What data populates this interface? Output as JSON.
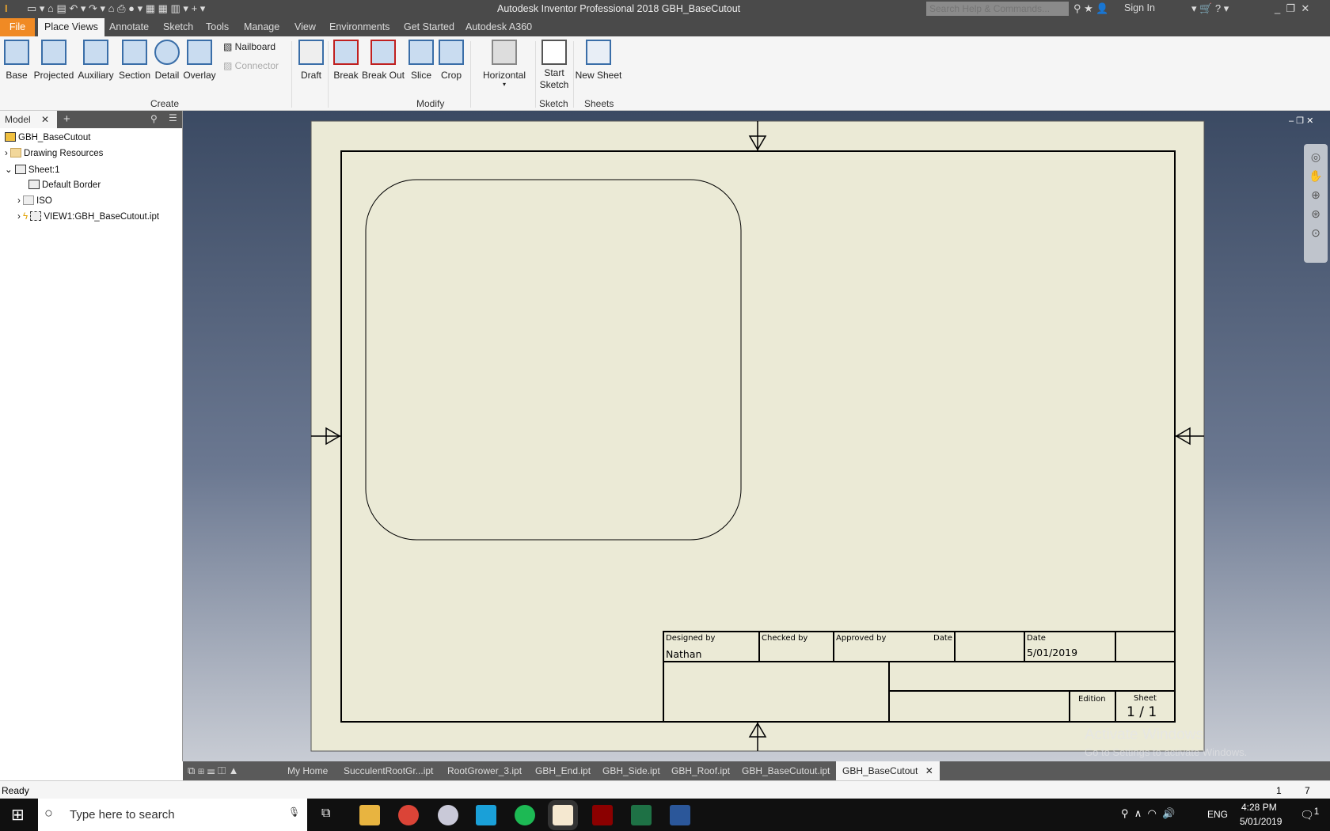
{
  "app": {
    "title": "Autodesk Inventor Professional 2018   GBH_BaseCutout",
    "search_placeholder": "Search Help & Commands...",
    "sign_in": "Sign In"
  },
  "ribbon_tabs": [
    "File",
    "Place Views",
    "Annotate",
    "Sketch",
    "Tools",
    "Manage",
    "View",
    "Environments",
    "Get Started",
    "Autodesk A360"
  ],
  "ribbon": {
    "buttons": [
      "Base",
      "Projected",
      "Auxiliary",
      "Section",
      "Detail",
      "Overlay",
      "Draft",
      "Break",
      "Break Out",
      "Slice",
      "Crop",
      "Horizontal",
      "Start Sketch",
      "New Sheet"
    ],
    "small": [
      "Nailboard",
      "Connector"
    ],
    "groups": [
      "Create",
      "Modify",
      "Sketch",
      "Sheets"
    ]
  },
  "browser": {
    "tab": "Model",
    "items": [
      "GBH_BaseCutout",
      "Drawing Resources",
      "Sheet:1",
      "Default Border",
      "ISO",
      "VIEW1:GBH_BaseCutout.ipt"
    ]
  },
  "title_block": {
    "designed_by_label": "Designed by",
    "designed_by": "Nathan",
    "checked_by_label": "Checked by",
    "approved_by_label": "Approved by",
    "date_label": "Date",
    "date_label2": "Date",
    "date": "5/01/2019",
    "edition_label": "Edition",
    "sheet_label": "Sheet",
    "sheet": "1 / 1"
  },
  "doc_tabs": [
    "My Home",
    "SucculentRootGr...ipt",
    "RootGrower_3.ipt",
    "GBH_End.ipt",
    "GBH_Side.ipt",
    "GBH_Roof.ipt",
    "GBH_BaseCutout.ipt",
    "GBH_BaseCutout"
  ],
  "status": {
    "text": "Ready",
    "count1": "1",
    "count2": "7"
  },
  "watermark": {
    "line1": "Activate Windows",
    "line2": "Go to Settings to activate Windows."
  },
  "taskbar": {
    "search_placeholder": "Type here to search",
    "lang": "ENG",
    "time": "4:28 PM",
    "date": "5/01/2019",
    "notifications": "1"
  },
  "colors": {
    "file_tab": "#f08a24",
    "sheet": "#ebead6",
    "ribbon": "#f5f5f5"
  }
}
